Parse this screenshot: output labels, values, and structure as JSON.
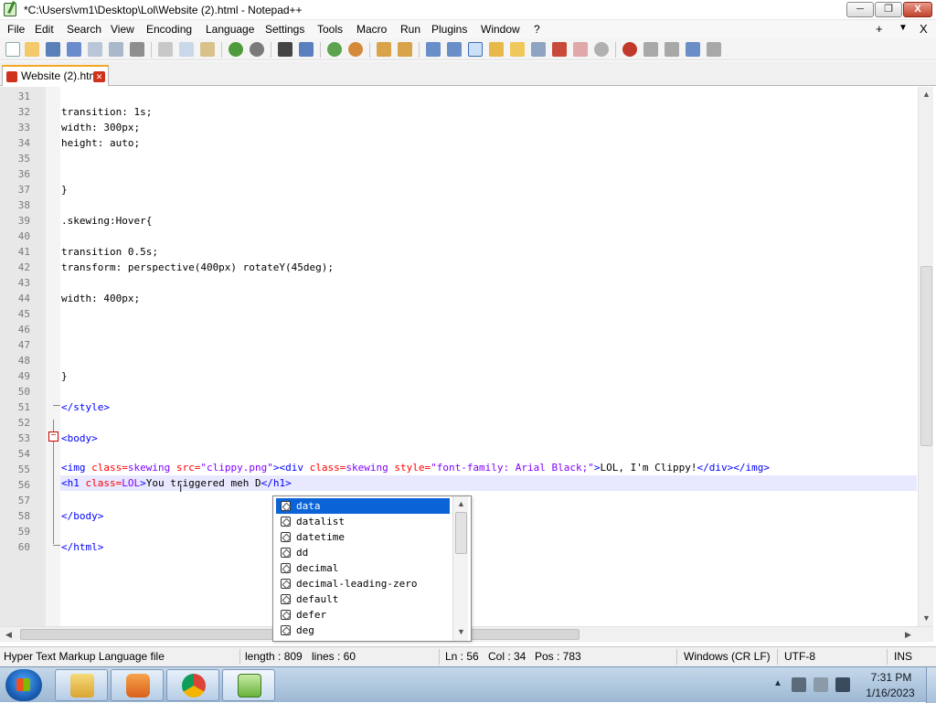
{
  "window": {
    "title": "*C:\\Users\\vm1\\Desktop\\Lol\\Website (2).html - Notepad++",
    "min_icon": "minimize-icon",
    "max_icon": "maximize-icon",
    "close_icon": "close-icon",
    "min_glyph": "─",
    "max_glyph": "❐",
    "close_glyph": "X"
  },
  "menubar": {
    "items": [
      "File",
      "Edit",
      "Search",
      "View",
      "Encoding",
      "Language",
      "Settings",
      "Tools",
      "Macro",
      "Run",
      "Plugins",
      "Window",
      "?"
    ],
    "right_plus": "+",
    "right_down": "▼",
    "right_close": "X"
  },
  "toolbar": {
    "icons": [
      "new-file-icon",
      "open-file-icon",
      "save-icon",
      "save-all-icon",
      "close-icon",
      "close-all-icon",
      "print-icon",
      "cut-icon",
      "copy-icon",
      "paste-icon",
      "undo-icon",
      "redo-icon",
      "find-icon",
      "replace-icon",
      "zoom-in-icon",
      "zoom-out-icon",
      "sync-v-icon",
      "sync-h-icon",
      "wrap-icon",
      "show-all-chars-icon",
      "indent-guide-icon",
      "doc-map-icon",
      "function-list-icon",
      "folder-as-workspace-icon",
      "monitoring-icon",
      "record-macro-icon",
      "stop-macro-icon",
      "play-macro-icon",
      "run-macro-multiple-icon",
      "save-macro-icon"
    ]
  },
  "tabs": [
    {
      "label": "Website (2).html",
      "close_glyph": "✕"
    }
  ],
  "editor": {
    "lines": [
      {
        "num": "31",
        "text": ""
      },
      {
        "num": "32",
        "text": "transition: 1s;"
      },
      {
        "num": "33",
        "text": "width: 300px;"
      },
      {
        "num": "34",
        "text": "height: auto;"
      },
      {
        "num": "35",
        "text": ""
      },
      {
        "num": "36",
        "text": ""
      },
      {
        "num": "37",
        "text": "}"
      },
      {
        "num": "38",
        "text": ""
      },
      {
        "num": "39",
        "text": ".skewing:Hover{"
      },
      {
        "num": "40",
        "text": ""
      },
      {
        "num": "41",
        "text": "transition 0.5s;"
      },
      {
        "num": "42",
        "text": "transform: perspective(400px) rotateY(45deg);"
      },
      {
        "num": "43",
        "text": ""
      },
      {
        "num": "44",
        "text": "width: 400px;"
      },
      {
        "num": "45",
        "text": ""
      },
      {
        "num": "46",
        "text": ""
      },
      {
        "num": "47",
        "text": ""
      },
      {
        "num": "48",
        "text": ""
      },
      {
        "num": "49",
        "text": "}"
      },
      {
        "num": "50",
        "text": ""
      },
      {
        "num": "51",
        "text": "</style>"
      },
      {
        "num": "52",
        "text": ""
      },
      {
        "num": "53",
        "text": "<body>"
      },
      {
        "num": "54",
        "text": ""
      },
      {
        "num": "55",
        "text": ""
      },
      {
        "num": "56",
        "text": ""
      },
      {
        "num": "57",
        "text": ""
      },
      {
        "num": "58",
        "text": "</body>"
      },
      {
        "num": "59",
        "text": ""
      },
      {
        "num": "60",
        "text": "</html>"
      }
    ],
    "line55": {
      "t1": "<img ",
      "a1": "class=",
      "v1": "skewing",
      "sp1": " ",
      "a2": "src=",
      "v2": "\"clippy.png\"",
      "t2": "><div ",
      "a3": "class=",
      "v3": "skewing",
      "sp2": " ",
      "a4": "style=",
      "v4": "\"font-family: Arial Black;\"",
      "t3": ">",
      "text": "LOL, I'm Clippy!",
      "t4": "</div></img>"
    },
    "line56": {
      "t1": "<h1 ",
      "a1": "class=",
      "v1": "LOL",
      "t2": ">",
      "text": "You triggered meh D",
      "t3": "</h1>"
    }
  },
  "autocomplete": {
    "items": [
      "data",
      "datalist",
      "datetime",
      "dd",
      "decimal",
      "decimal-leading-zero",
      "default",
      "defer",
      "deg"
    ],
    "selected": "data"
  },
  "statusbar": {
    "file_type": "Hyper Text Markup Language file",
    "length": "length : 809",
    "lines": "lines : 60",
    "ln": "Ln : 56",
    "col": "Col : 34",
    "pos": "Pos : 783",
    "eol": "Windows (CR LF)",
    "encoding": "UTF-8",
    "mode": "INS"
  },
  "taskbar": {
    "tasks": [
      "explorer-icon",
      "media-player-icon",
      "chrome-icon",
      "notepadpp-icon"
    ],
    "tray_up": "▲",
    "time": "7:31 PM",
    "date": "1/16/2023"
  },
  "colors": {
    "selection": "#0a64d8",
    "tag": "#0000ff",
    "attr": "#ff0000",
    "value": "#8000ff",
    "accent_tab": "#f5a623"
  }
}
